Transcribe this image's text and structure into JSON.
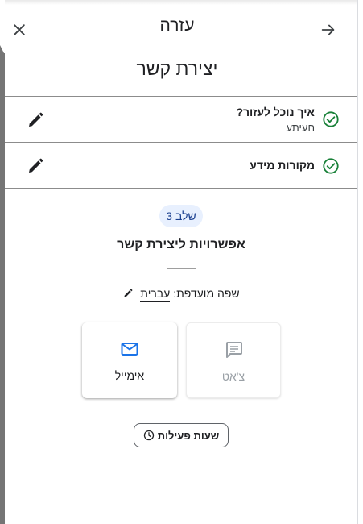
{
  "header": {
    "title": "עזרה",
    "subtitle": "יצירת קשר",
    "close_icon": "close-icon",
    "forward_icon": "arrow-forward-icon"
  },
  "steps": [
    {
      "title": "איך נוכל לעזור?",
      "value": "חעיתע",
      "status": "completed"
    },
    {
      "title": "מקורות מידע",
      "status": "completed"
    }
  ],
  "main": {
    "step_badge": "שלב 3",
    "options_title": "אפשרויות ליצירת קשר",
    "language_label": "שפה מועדפת:",
    "language_value": "עברית",
    "options": [
      {
        "label": "אימייל",
        "icon": "mail-icon",
        "enabled": true
      },
      {
        "label": "צ'אט",
        "icon": "chat-icon",
        "enabled": false
      }
    ],
    "hours_button": "שעות פעילות"
  },
  "colors": {
    "check": "#188038",
    "accent": "#1a73e8",
    "badge_bg": "#e8f0fe",
    "disabled": "#9aa0a6"
  }
}
